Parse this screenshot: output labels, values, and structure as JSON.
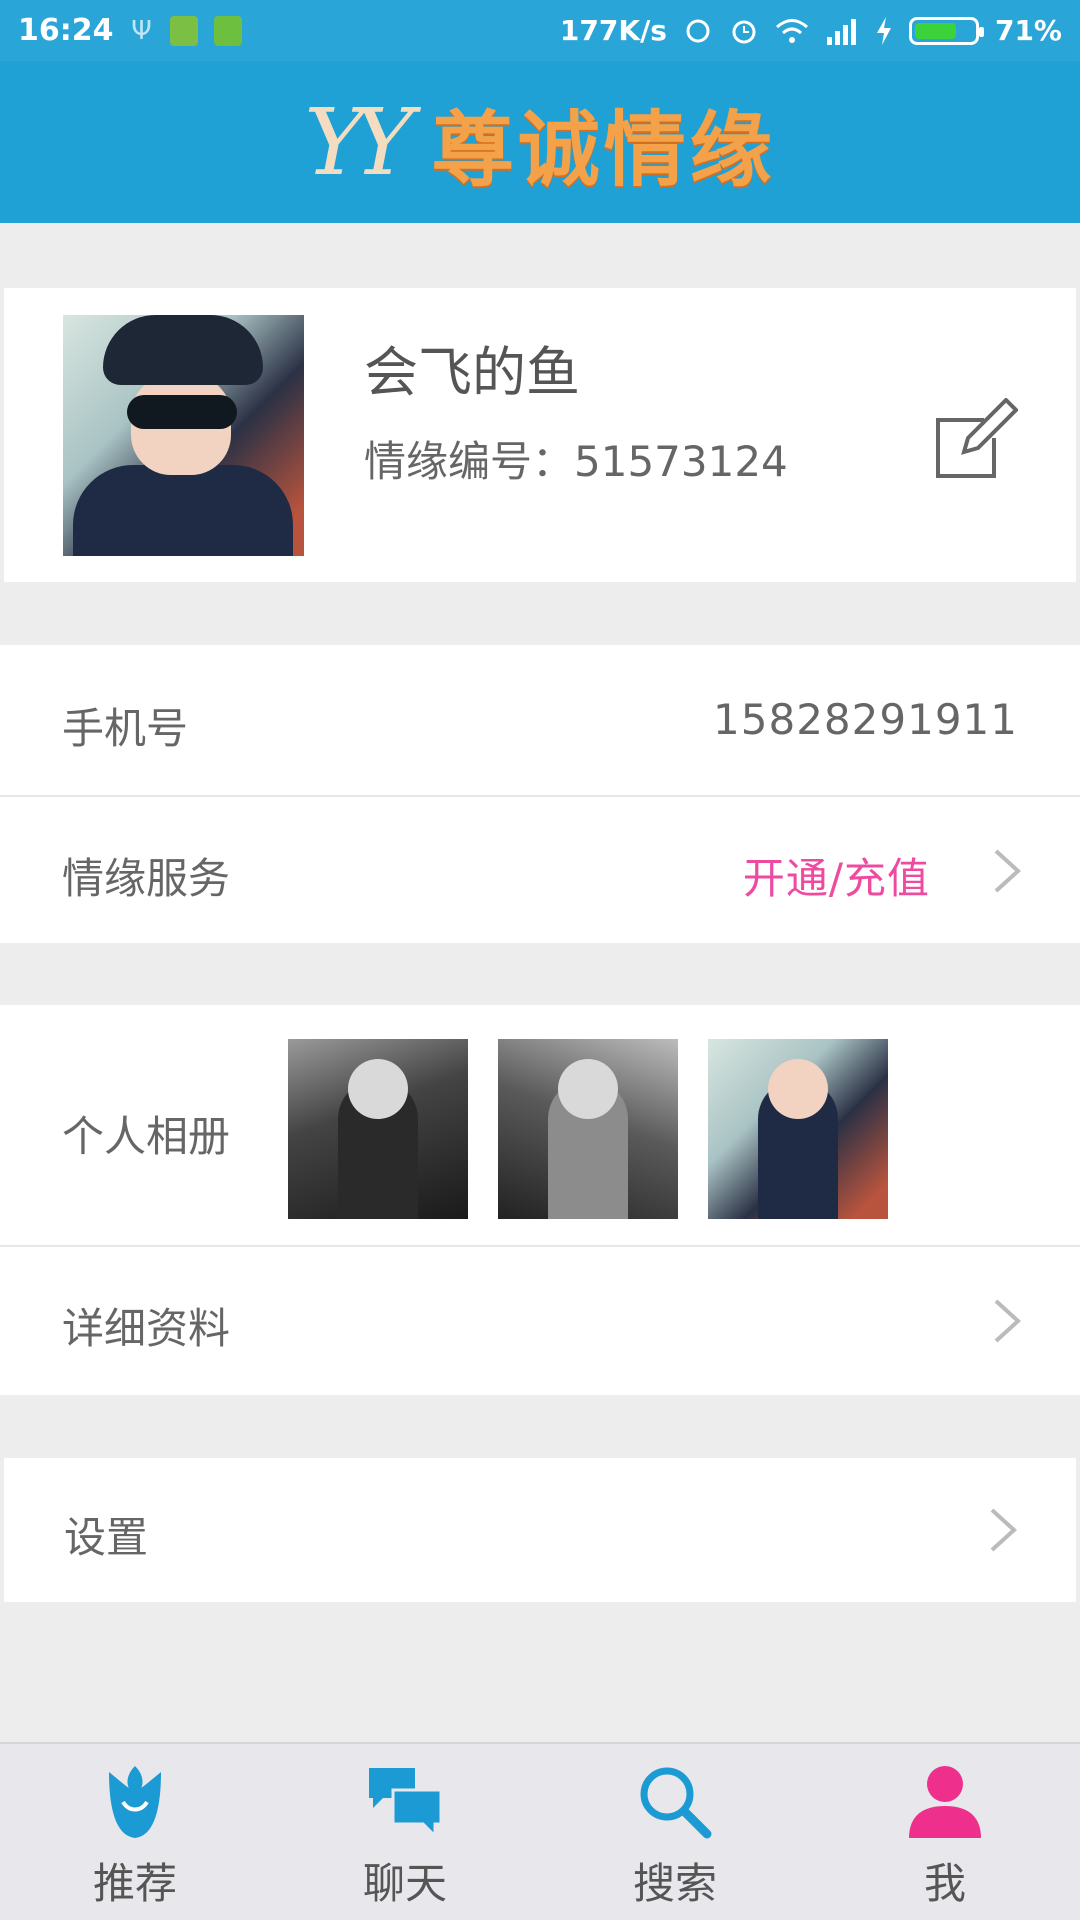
{
  "status_bar": {
    "time": "16:24",
    "net_speed": "177K/s",
    "battery_text": "71%",
    "battery_level": 0.71,
    "icons": [
      "usb-icon",
      "battery-app-icon",
      "android-icon",
      "sync-icon",
      "alarm-icon",
      "wifi-icon",
      "signal-icon",
      "charging-icon",
      "battery-icon"
    ]
  },
  "header": {
    "logo_mark": "YY",
    "title": "尊诚情缘"
  },
  "profile": {
    "name": "会飞的鱼",
    "id_line": "情缘编号：51573124",
    "edit_icon": "edit-icon"
  },
  "phone_row": {
    "label": "手机号",
    "value": "15828291911"
  },
  "service_row": {
    "label": "情缘服务",
    "action": "开通/充值",
    "action_color": "#ee4aa0"
  },
  "album_row": {
    "label": "个人相册",
    "photo_count": 3
  },
  "details_row": {
    "label": "详细资料"
  },
  "settings_row": {
    "label": "设置"
  },
  "tabs": [
    {
      "label": "推荐",
      "icon": "rose-icon",
      "color": "#1b9ad3"
    },
    {
      "label": "聊天",
      "icon": "chat-bubbles-icon",
      "color": "#1b9ad3"
    },
    {
      "label": "搜索",
      "icon": "search-icon",
      "color": "#1b9ad3"
    },
    {
      "label": "我",
      "icon": "person-icon",
      "color": "#ee2f8c"
    }
  ],
  "colors": {
    "status_bar": "#2aa5d8",
    "header": "#1fa1d6",
    "accent_pink": "#ee4aa0",
    "background": "#ededee"
  }
}
